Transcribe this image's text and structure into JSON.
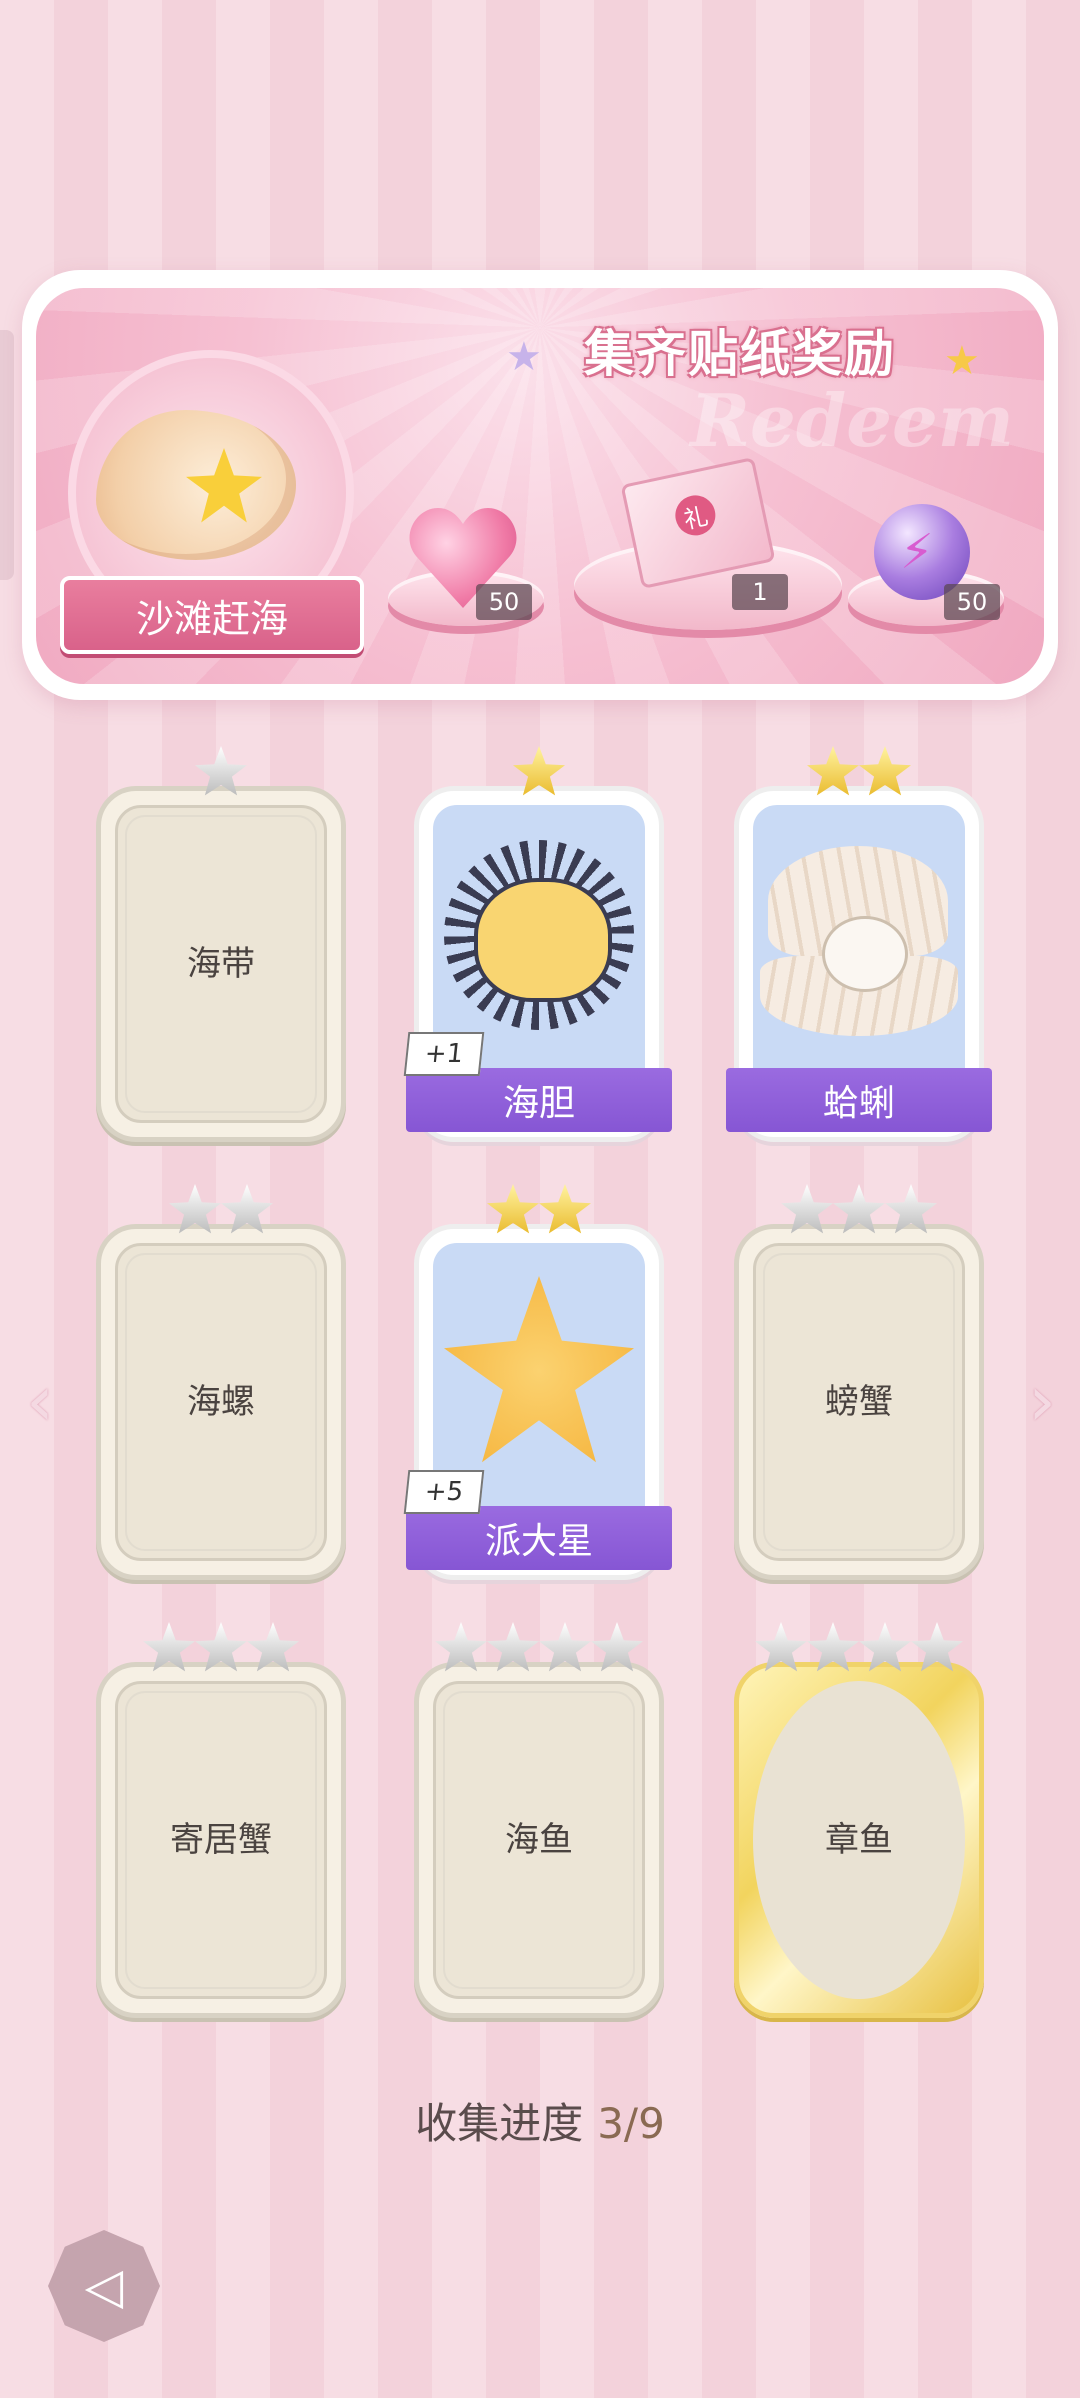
{
  "banner": {
    "title": "集齐贴纸奖励",
    "watermark": "Redeem",
    "collection_name": "沙滩赶海",
    "rewards": [
      {
        "icon": "heart-gem-icon",
        "count": "50"
      },
      {
        "icon": "gift-box-icon",
        "count": "1"
      },
      {
        "icon": "purple-orb-icon",
        "count": "50"
      }
    ]
  },
  "cards": [
    {
      "name": "海带",
      "stars": 1,
      "collected": false
    },
    {
      "name": "海胆",
      "stars": 1,
      "collected": true,
      "badge": "+1"
    },
    {
      "name": "蛤蜊",
      "stars": 2,
      "collected": true
    },
    {
      "name": "海螺",
      "stars": 2,
      "collected": false
    },
    {
      "name": "派大星",
      "stars": 2,
      "collected": true,
      "badge": "+5"
    },
    {
      "name": "螃蟹",
      "stars": 3,
      "collected": false
    },
    {
      "name": "寄居蟹",
      "stars": 3,
      "collected": false
    },
    {
      "name": "海鱼",
      "stars": 4,
      "collected": false
    },
    {
      "name": "章鱼",
      "stars": 4,
      "collected": false,
      "gold": true
    }
  ],
  "progress": {
    "label": "收集进度",
    "value": "3/9"
  },
  "colors": {
    "accent_purple": "#8656d4",
    "banner_pink": "#f0a8c0",
    "star_gold": "#e9b92a"
  }
}
